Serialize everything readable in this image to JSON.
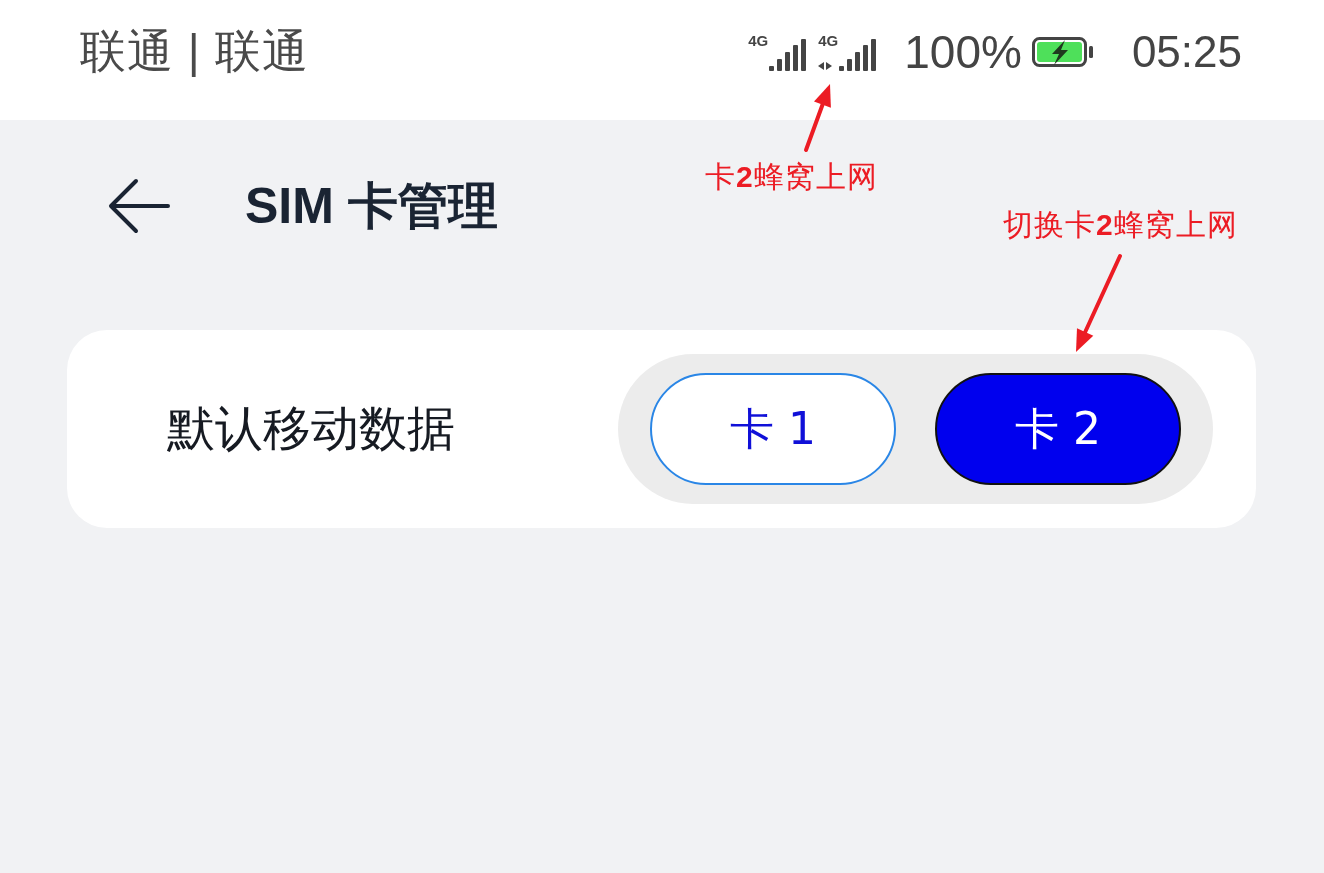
{
  "status_bar": {
    "carrier": "联通 | 联通",
    "signals": [
      {
        "network": "4G",
        "data_active": false
      },
      {
        "network": "4G",
        "data_active": true
      }
    ],
    "battery": {
      "percent": "100%",
      "charging": true
    },
    "time": "05:25"
  },
  "header": {
    "title": "SIM 卡管理"
  },
  "annotations": [
    {
      "text": "卡**2**蜂窝上网"
    },
    {
      "text": "切换卡**2**蜂窝上网"
    }
  ],
  "default_data": {
    "label": "默认移动数据",
    "sims": [
      {
        "label": "卡 1",
        "selected": false
      },
      {
        "label": "卡 2",
        "selected": true
      }
    ]
  }
}
